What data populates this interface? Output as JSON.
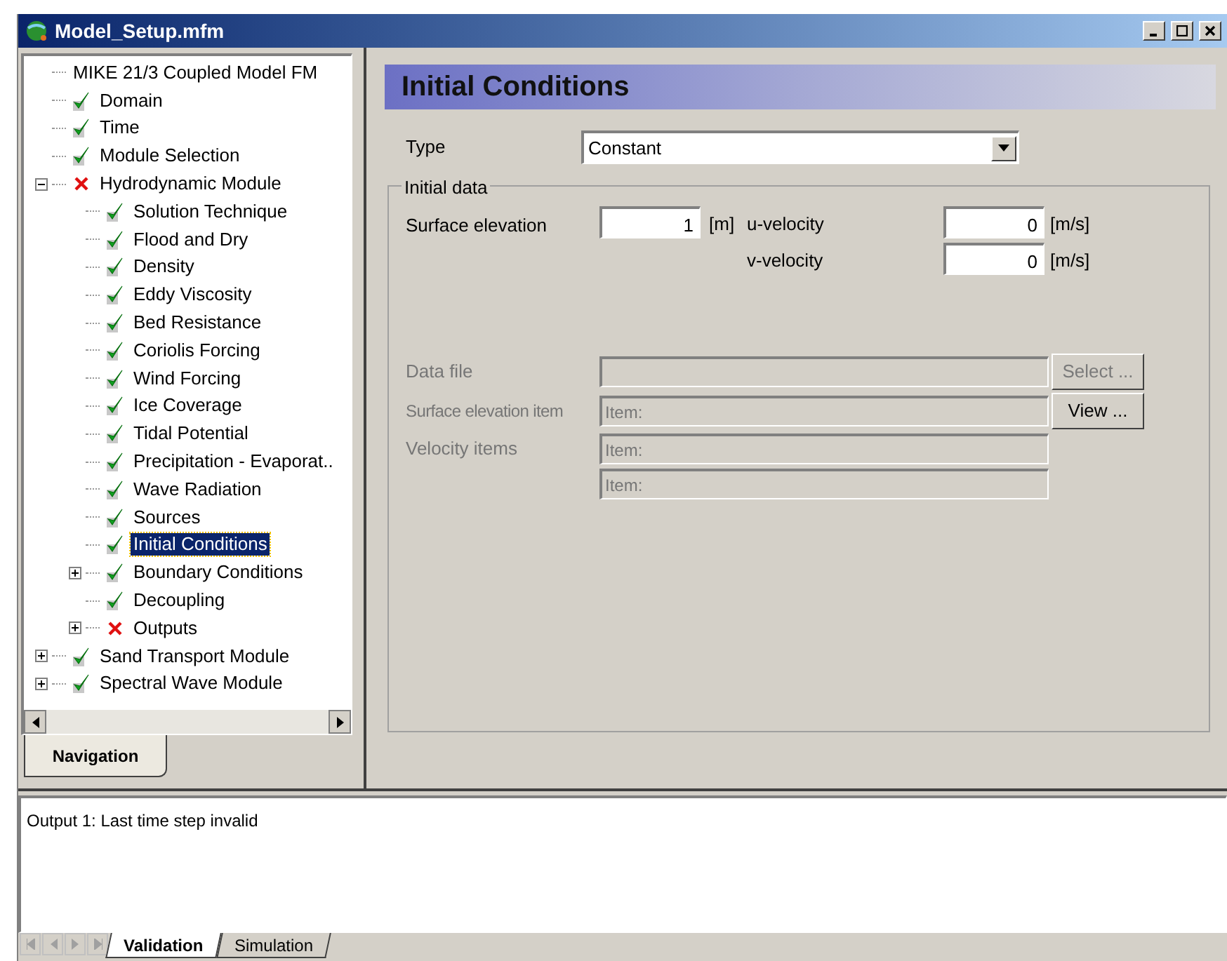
{
  "window": {
    "title": "Model_Setup.mfm"
  },
  "tree": [
    {
      "label": "MIKE 21/3 Coupled Model FM",
      "kind": "plain",
      "selected": false
    },
    {
      "label": "Domain",
      "kind": "ok",
      "selected": false
    },
    {
      "label": "Time",
      "kind": "ok",
      "selected": false
    },
    {
      "label": "Module Selection",
      "kind": "ok",
      "selected": false
    },
    {
      "label": "Hydrodynamic Module",
      "kind": "error",
      "selected": false,
      "expanded": true,
      "children": [
        {
          "label": "Solution Technique",
          "kind": "ok",
          "selected": false
        },
        {
          "label": "Flood and Dry",
          "kind": "ok",
          "selected": false
        },
        {
          "label": "Density",
          "kind": "ok",
          "selected": false
        },
        {
          "label": "Eddy Viscosity",
          "kind": "ok",
          "selected": false
        },
        {
          "label": "Bed Resistance",
          "kind": "ok",
          "selected": false
        },
        {
          "label": "Coriolis Forcing",
          "kind": "ok",
          "selected": false
        },
        {
          "label": "Wind Forcing",
          "kind": "ok",
          "selected": false
        },
        {
          "label": "Ice Coverage",
          "kind": "ok",
          "selected": false
        },
        {
          "label": "Tidal Potential",
          "kind": "ok",
          "selected": false
        },
        {
          "label": "Precipitation - Evaporat..",
          "kind": "ok",
          "selected": false
        },
        {
          "label": "Wave Radiation",
          "kind": "ok",
          "selected": false
        },
        {
          "label": "Sources",
          "kind": "ok",
          "selected": false
        },
        {
          "label": "Initial Conditions",
          "kind": "ok",
          "selected": true
        },
        {
          "label": "Boundary Conditions",
          "kind": "ok",
          "selected": false,
          "expanded": false
        },
        {
          "label": "Decoupling",
          "kind": "ok",
          "selected": false
        },
        {
          "label": "Outputs",
          "kind": "error",
          "selected": false,
          "expanded": false
        }
      ]
    },
    {
      "label": "Sand Transport Module",
      "kind": "ok",
      "selected": false,
      "expanded": false
    },
    {
      "label": "Spectral Wave Module",
      "kind": "ok",
      "selected": false,
      "expanded": false
    }
  ],
  "nav_tab": {
    "label": "Navigation",
    "selected": true
  },
  "panel": {
    "title": "Initial Conditions",
    "type_label": "Type",
    "type_value": "Constant",
    "group_title": "Initial data",
    "surface_elevation": {
      "label": "Surface elevation",
      "value": "1",
      "unit": "[m]"
    },
    "u_velocity": {
      "label": "u-velocity",
      "value": "0",
      "unit": "[m/s]"
    },
    "v_velocity": {
      "label": "v-velocity",
      "value": "0",
      "unit": "[m/s]"
    },
    "data_file": {
      "label": "Data file",
      "disabled": true
    },
    "surface_item": {
      "label": "Surface elevation item",
      "placeholder": "Item:",
      "disabled": true
    },
    "velocity_items": {
      "label": "Velocity items",
      "placeholders": [
        "Item:",
        "Item:"
      ],
      "disabled": true
    },
    "select_button": {
      "label": "Select ...",
      "disabled": true
    },
    "view_button": {
      "label": "View ...",
      "disabled": false
    }
  },
  "output": {
    "message": "Output 1: Last time step invalid"
  },
  "output_tabs": [
    {
      "label": "Validation",
      "selected": true
    },
    {
      "label": "Simulation",
      "selected": false
    }
  ]
}
